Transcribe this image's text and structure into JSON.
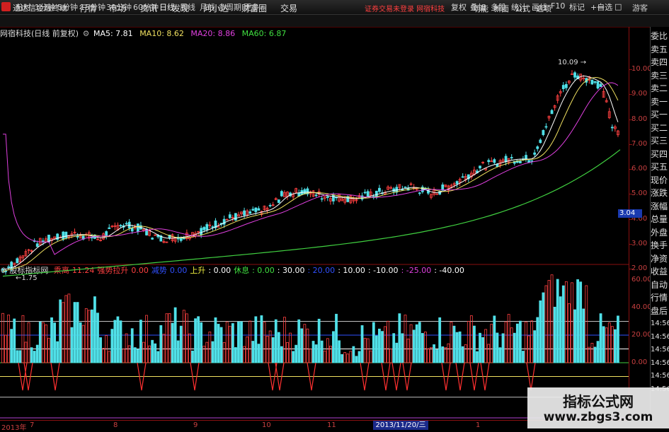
{
  "app": {
    "title": "通达信金融终端"
  },
  "menu": [
    "行情",
    "市场",
    "资讯",
    "发现",
    "问小达",
    "财富圈",
    "交易"
  ],
  "notice": "证券交易未登录   网宿科技",
  "right_menu": [
    "功能",
    "新面",
    "公式",
    "选项"
  ],
  "window_controls": {
    "btn1": "—",
    "btn2": "□",
    "btn3": "游客"
  },
  "periods": [
    "分时",
    "1分钟",
    "5分钟",
    "15分钟",
    "30分钟",
    "60分钟",
    "日线",
    "周线",
    "月线",
    "多周期",
    "更多"
  ],
  "active_period": "日线",
  "toolbar_right": [
    "复权",
    "叠加",
    "多股",
    "统计",
    "画线",
    "F10",
    "标记",
    "+自选"
  ],
  "main_chart": {
    "title": "网宿科技(日线 前复权)",
    "ma": [
      {
        "label": "MA5: 7.81",
        "color": "#ffffff"
      },
      {
        "label": "MA10: 8.62",
        "color": "#f0e060"
      },
      {
        "label": "MA20: 8.86",
        "color": "#e040e0"
      },
      {
        "label": "MA60: 6.87",
        "color": "#40e040"
      }
    ],
    "price_labels": [
      "10.00",
      "9.00",
      "8.00",
      "7.00",
      "6.00",
      "5.00",
      "4.00",
      "3.00",
      "2.00"
    ],
    "high_label": "10.09",
    "low_label": "1.75",
    "current_price": "3.04"
  },
  "sub_chart": {
    "title": "股标指标网",
    "items": [
      {
        "text": "乘离",
        "color": "#ff4040"
      },
      {
        "text": "11.24",
        "color": "#ff4040"
      },
      {
        "text": "强势拉升",
        "color": "#ff4040"
      },
      {
        "text": "0.00",
        "color": "#ff4040"
      },
      {
        "text": "减势",
        "color": "#3050ff"
      },
      {
        "text": "0.00",
        "color": "#3050ff"
      },
      {
        "text": "上升",
        "color": "#f0f040"
      },
      {
        "text": ": 0.00",
        "color": "#ffffff"
      },
      {
        "text": "休息",
        "color": "#40e040"
      },
      {
        "text": ": 0.00",
        "color": "#40e040"
      },
      {
        "text": ": 30.00",
        "color": "#ffffff"
      },
      {
        "text": ": 20.00",
        "color": "#3050ff"
      },
      {
        "text": ": 10.00",
        "color": "#ffffff"
      },
      {
        "text": ": -10.00",
        "color": "#ffffff"
      },
      {
        "text": ": -25.00",
        "color": "#e040e0"
      },
      {
        "text": ": -40.00",
        "color": "#ffffff"
      }
    ],
    "axis_labels": [
      "60.00",
      "40.00",
      "20.00",
      "0.00"
    ]
  },
  "sidebar": [
    "委比",
    "卖五",
    "卖四",
    "卖三",
    "卖二",
    "卖一",
    "买一",
    "买二",
    "买三",
    "买四",
    "买五",
    "现价",
    "涨跌",
    "涨幅",
    "总量",
    "外盘",
    "换手",
    "净资",
    "收益",
    "自动",
    "行情",
    "盘后",
    "14:56",
    "14:56",
    "14:56",
    "14:56",
    "14:56",
    "14:56"
  ],
  "dates": [
    "2013年",
    "7",
    "8",
    "9",
    "10",
    "11",
    "1"
  ],
  "date_highlight": "2013/11/20/三",
  "watermark": {
    "title": "指标公式网",
    "url": "www.zbgs3.com"
  }
}
